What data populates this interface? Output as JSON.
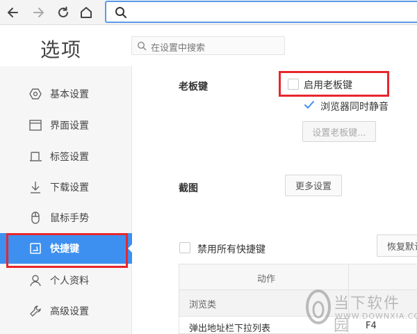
{
  "browser": {
    "address_value": ""
  },
  "header": {
    "title": "选项",
    "search_placeholder": "在设置中搜索"
  },
  "sidebar": {
    "items": [
      {
        "label": "基本设置",
        "icon": "hexagon-settings-icon"
      },
      {
        "label": "界面设置",
        "icon": "window-icon"
      },
      {
        "label": "标签设置",
        "icon": "tab-icon"
      },
      {
        "label": "下载设置",
        "icon": "download-arrow-icon"
      },
      {
        "label": "鼠标手势",
        "icon": "mouse-icon"
      },
      {
        "label": "快捷键",
        "icon": "keyboard-shortcut-icon",
        "active": true
      },
      {
        "label": "个人资料",
        "icon": "person-icon"
      },
      {
        "label": "高级设置",
        "icon": "wrench-icon"
      }
    ]
  },
  "boss_key": {
    "section": "老板键",
    "enable_label": "启用老板键",
    "enable_checked": false,
    "mute_label": "浏览器同时静音",
    "mute_checked": true,
    "set_button": "设置老板键..."
  },
  "screenshot": {
    "section": "截图",
    "more_button": "更多设置"
  },
  "shortcuts": {
    "disable_all_label": "禁用所有快捷键",
    "disable_all_checked": false,
    "restore_button": "恢复默认",
    "table": {
      "header_action": "动作",
      "group": "浏览类",
      "rows": [
        {
          "action": "弹出地址栏下拉列表",
          "key": "F4"
        }
      ]
    }
  },
  "watermark": {
    "text": "当下软件园",
    "url": "WWW.DOWNXIA.COM"
  },
  "colors": {
    "accent": "#3d90f0",
    "highlight_red": "#e8262c",
    "address_border": "#5a9be8"
  }
}
